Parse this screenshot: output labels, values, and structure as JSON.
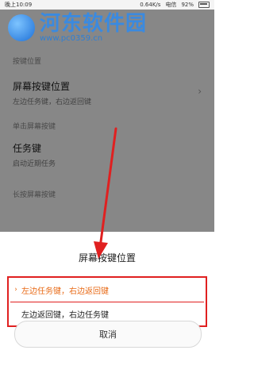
{
  "status_bar": {
    "time": "晚上10:09",
    "network_speed": "0.64K/s",
    "carrier": "电信",
    "battery": "92%"
  },
  "watermark": {
    "title": "河东软件园",
    "url": "www.pc0359.cn"
  },
  "settings": {
    "section_key_position": "按键位置",
    "screen_key_position": {
      "title": "屏幕按键位置",
      "subtitle": "左边任务键，右边返回键"
    },
    "section_single_tap": "单击屏幕按键",
    "task_key": {
      "title": "任务键",
      "subtitle": "启动近期任务"
    },
    "section_long_press": "长按屏幕按键"
  },
  "dialog": {
    "title": "屏幕按键位置",
    "options": [
      {
        "label": "左边任务键，右边返回键",
        "selected": true
      },
      {
        "label": "左边返回键，右边任务键",
        "selected": false
      }
    ],
    "cancel_label": "取消"
  },
  "colors": {
    "accent": "#e86a16",
    "annotation": "#e02020"
  },
  "icons": [
    "battery-icon",
    "chevron-right-icon",
    "selected-marker-icon",
    "annotation-arrow-icon"
  ]
}
